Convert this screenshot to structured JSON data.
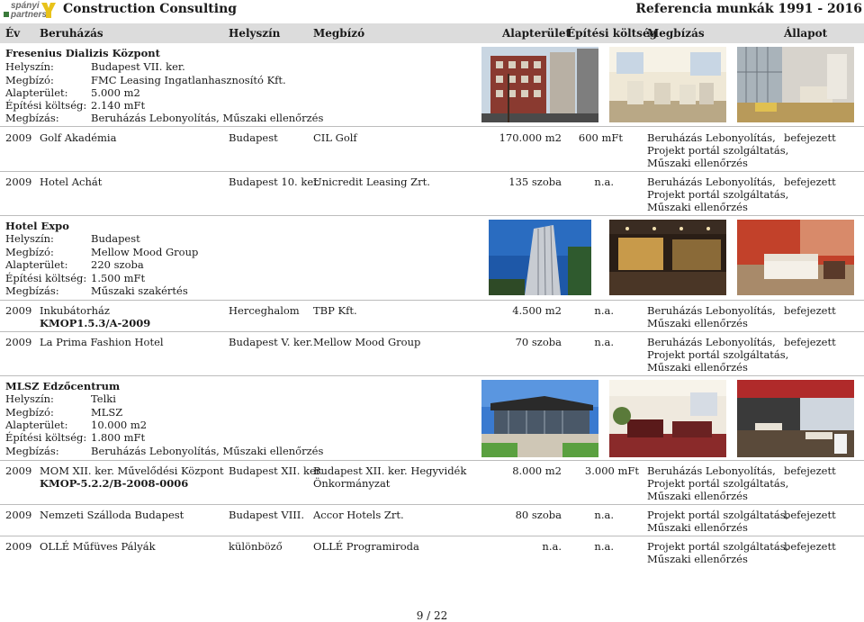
{
  "header": {
    "logo_line1": "spányi",
    "logo_line2": "partners",
    "title": "Construction Consulting",
    "right": "Referencia munkák 1991 - 2016"
  },
  "columns": {
    "ev": "Év",
    "beruhazas": "Beruházás",
    "helyszin": "Helyszín",
    "megbizo": "Megbízó",
    "alapterulet": "Alapterület",
    "koltseg": "Építési költség",
    "megbizas": "Megbízás",
    "allapot": "Állapot"
  },
  "labels": {
    "helyszin": "Helyszín:",
    "megbizo": "Megbízó:",
    "alapterulet": "Alapterület:",
    "koltseg": "Építési költség:",
    "megbizas": "Megbízás:"
  },
  "featured": [
    {
      "title": "Fresenius Dializis Központ",
      "helyszin": "Budapest VII. ker.",
      "megbizo": "FMC Leasing Ingatlanhasznosító Kft.",
      "alapterulet": "5.000 m2",
      "koltseg": "2.140 mFt",
      "megbizas": "Beruházás Lebonyolítás, Műszaki ellenőrzés"
    },
    {
      "title": "Hotel Expo",
      "helyszin": "Budapest",
      "megbizo": "Mellow Mood Group",
      "alapterulet": "220 szoba",
      "koltseg": "1.500 mFt",
      "megbizas": "Műszaki szakértés"
    },
    {
      "title": "MLSZ Edzőcentrum",
      "helyszin": "Telki",
      "megbizo": "MLSZ",
      "alapterulet": "10.000 m2",
      "koltseg": "1.800 mFt",
      "megbizas": "Beruházás Lebonyolítás, Műszaki ellenőrzés"
    }
  ],
  "rows": [
    {
      "ev": "2009",
      "nev": "Golf Akadémia",
      "nev2": "",
      "helyszin": "Budapest",
      "megbizo": "CIL Golf",
      "megbizo2": "",
      "alapterulet": "170.000 m2",
      "koltseg": "600 mFt",
      "megbizas": [
        "Beruházás Lebonyolítás,",
        "Projekt portál szolgáltatás,",
        "Műszaki ellenőrzés"
      ],
      "allapot": "befejezett"
    },
    {
      "ev": "2009",
      "nev": "Hotel Achát",
      "nev2": "",
      "helyszin": "Budapest 10. ker.",
      "megbizo": "Unicredit Leasing Zrt.",
      "megbizo2": "",
      "alapterulet": "135 szoba",
      "koltseg": "n.a.",
      "megbizas": [
        "Beruházás Lebonyolítás,",
        "Projekt portál szolgáltatás,",
        "Műszaki ellenőrzés"
      ],
      "allapot": "befejezett"
    },
    {
      "ev": "2009",
      "nev": "Inkubátorház",
      "nev2": "KMOP1.5.3/A-2009",
      "helyszin": "Herceghalom",
      "megbizo": "TBP Kft.",
      "megbizo2": "",
      "alapterulet": "4.500 m2",
      "koltseg": "n.a.",
      "megbizas": [
        "Beruházás Lebonyolítás,",
        "Műszaki ellenőrzés",
        ""
      ],
      "allapot": "befejezett"
    },
    {
      "ev": "2009",
      "nev": "La Prima Fashion Hotel",
      "nev2": "",
      "helyszin": "Budapest V. ker.",
      "megbizo": "Mellow Mood Group",
      "megbizo2": "",
      "alapterulet": "70 szoba",
      "koltseg": "n.a.",
      "megbizas": [
        "Beruházás Lebonyolítás,",
        "Projekt portál szolgáltatás,",
        "Műszaki ellenőrzés"
      ],
      "allapot": "befejezett"
    },
    {
      "ev": "2009",
      "nev": "MOM XII. ker. Művelődési Központ",
      "nev2": "KMOP-5.2.2/B-2008-0006",
      "helyszin": "Budapest XII. ker.",
      "megbizo": "Budapest XII. ker. Hegyvidék",
      "megbizo2": "Önkormányzat",
      "alapterulet": "8.000 m2",
      "koltseg": "3.000 mFt",
      "megbizas": [
        "Beruházás Lebonyolítás,",
        "Projekt portál szolgáltatás,",
        "Műszaki ellenőrzés"
      ],
      "allapot": "befejezett"
    },
    {
      "ev": "2009",
      "nev": "Nemzeti Szálloda Budapest",
      "nev2": "",
      "helyszin": "Budapest VIII.",
      "megbizo": "Accor Hotels Zrt.",
      "megbizo2": "",
      "alapterulet": "80 szoba",
      "koltseg": "n.a.",
      "megbizas": [
        "Projekt portál szolgáltatás,",
        "Műszaki ellenőrzés",
        ""
      ],
      "allapot": "befejezett"
    },
    {
      "ev": "2009",
      "nev": "OLLÉ Műfüves Pályák",
      "nev2": "",
      "helyszin": "különböző",
      "megbizo": "OLLÉ Programiroda",
      "megbizo2": "",
      "alapterulet": "n.a.",
      "koltseg": "n.a.",
      "megbizas": [
        "Projekt portál szolgáltatás,",
        "Műszaki ellenőrzés",
        ""
      ],
      "allapot": "befejezett"
    }
  ],
  "pager": "9 / 22",
  "colors": {
    "header_bar": "#dcdcdc",
    "logo_yellow": "#e8c21a",
    "divider": "#bcbcbc"
  }
}
